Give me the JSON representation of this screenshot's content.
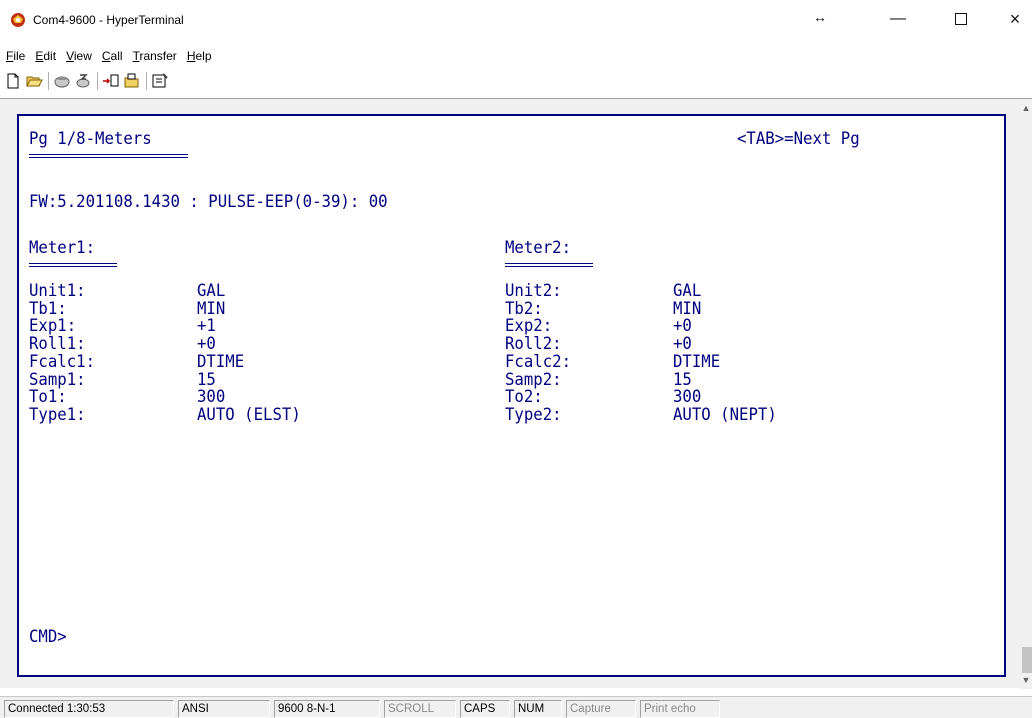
{
  "window": {
    "title": "Com4-9600 - HyperTerminal"
  },
  "menu": [
    "File",
    "Edit",
    "View",
    "Call",
    "Transfer",
    "Help"
  ],
  "terminal": {
    "page_title": "Pg 1/8-Meters",
    "next_hint": "<TAB>=Next Pg",
    "fw_line": "FW:5.201108.1430 : PULSE-EEP(0-39): 00",
    "meter1": {
      "heading": "Meter1:",
      "rows": [
        {
          "label": "Unit1:",
          "value": "GAL"
        },
        {
          "label": "Tb1:",
          "value": "MIN"
        },
        {
          "label": "Exp1:",
          "value": "+1"
        },
        {
          "label": "Roll1:",
          "value": "+0"
        },
        {
          "label": "Fcalc1:",
          "value": "DTIME"
        },
        {
          "label": "Samp1:",
          "value": "15"
        },
        {
          "label": "To1:",
          "value": "300"
        },
        {
          "label": "Type1:",
          "value": "AUTO (ELST)"
        }
      ]
    },
    "meter2": {
      "heading": "Meter2:",
      "rows": [
        {
          "label": "Unit2:",
          "value": "GAL"
        },
        {
          "label": "Tb2:",
          "value": "MIN"
        },
        {
          "label": "Exp2:",
          "value": "+0"
        },
        {
          "label": "Roll2:",
          "value": "+0"
        },
        {
          "label": "Fcalc2:",
          "value": "DTIME"
        },
        {
          "label": "Samp2:",
          "value": "15"
        },
        {
          "label": "To2:",
          "value": "300"
        },
        {
          "label": "Type2:",
          "value": "AUTO (NEPT)"
        }
      ]
    },
    "prompt": "CMD>"
  },
  "statusbar": {
    "connected": "Connected 1:30:53",
    "emulation": "ANSI",
    "settings": "9600 8-N-1",
    "scroll": "SCROLL",
    "caps": "CAPS",
    "num": "NUM",
    "capture": "Capture",
    "print_echo": "Print echo"
  },
  "icons": [
    "hyperterminal-app-icon",
    "new-file-icon",
    "open-folder-icon",
    "call-phone-icon",
    "disconnect-icon",
    "send-file-icon",
    "receive-file-icon",
    "properties-icon"
  ],
  "colors": {
    "terminal_text": "#000080"
  }
}
